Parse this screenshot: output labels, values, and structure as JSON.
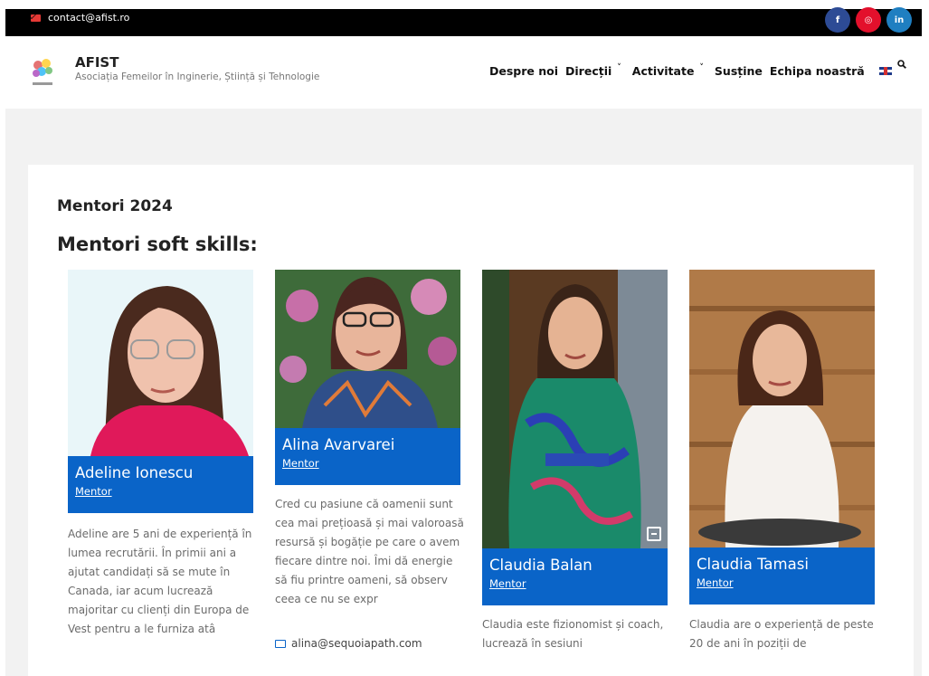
{
  "topbar": {
    "email": "contact@afist.ro",
    "social": [
      {
        "icon": "facebook-icon",
        "label": "f",
        "color": "#2d4b95"
      },
      {
        "icon": "instagram-icon",
        "label": "◎",
        "color": "#e3102c"
      },
      {
        "icon": "linkedin-icon",
        "label": "in",
        "color": "#1f7fc1"
      }
    ]
  },
  "header": {
    "brand_name": "AFIST",
    "brand_tagline": "Asociația Femeilor în Inginerie, Știință și Tehnologie",
    "nav": [
      {
        "label": "Despre noi",
        "dropdown": false
      },
      {
        "label": "Direcții",
        "dropdown": true
      },
      {
        "label": "Activitate",
        "dropdown": true
      },
      {
        "label": "Susține",
        "dropdown": false
      },
      {
        "label": "Echipa noastră",
        "dropdown": false
      }
    ]
  },
  "main": {
    "heading": "Mentori 2024",
    "subheading": "Mentori soft skills:",
    "mentors": [
      {
        "name": "Adeline Ionescu",
        "role": "Mentor",
        "bio": "Adeline are 5 ani de experiență în lumea recrutării. În primii ani a ajutat candidați să se mute în Canada, iar acum lucrează majoritar cu clienți din Europa de Vest pentru a le furniza atâ"
      },
      {
        "name": "Alina Avarvarei",
        "role": "Mentor",
        "bio": "Cred cu pasiune că oamenii sunt cea mai prețioasă și mai valoroasă resursă și bogăție pe care o avem fiecare dintre noi. Îmi dă energie să fiu printre oameni, să observ ceea ce nu se expr",
        "email": "alina@sequoiapath.com"
      },
      {
        "name": "Claudia Balan",
        "role": "Mentor",
        "bio": "Claudia este fizionomist și coach, lucrează în sesiuni"
      },
      {
        "name": "Claudia Tamasi",
        "role": "Mentor",
        "bio": "Claudia are o experiență de peste 20 de ani în poziții de"
      }
    ]
  }
}
